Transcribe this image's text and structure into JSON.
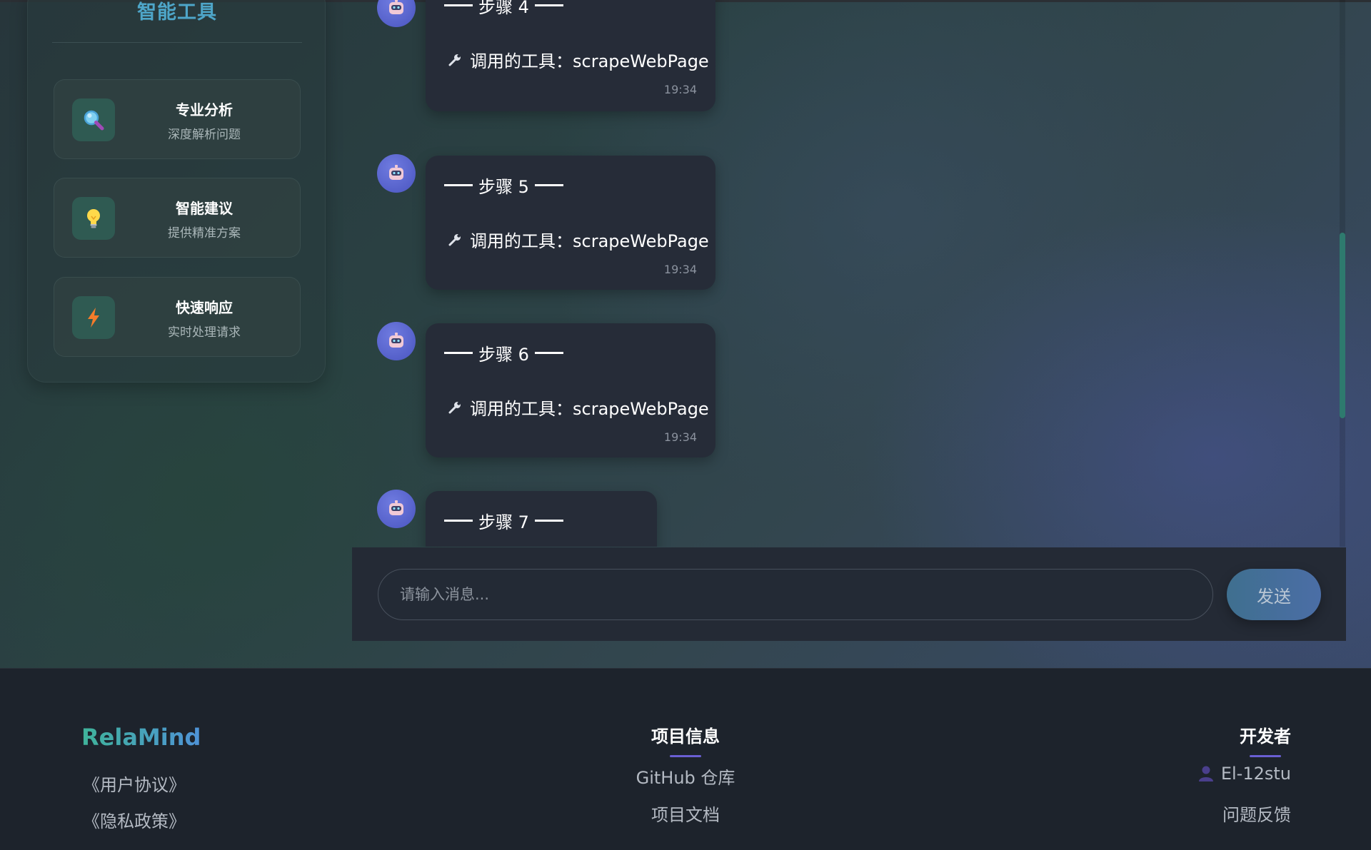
{
  "tools": {
    "title": "智能工具",
    "items": [
      {
        "name": "专业分析",
        "desc": "深度解析问题",
        "icon": "magnifier-icon"
      },
      {
        "name": "智能建议",
        "desc": "提供精准方案",
        "icon": "lightbulb-icon"
      },
      {
        "name": "快速响应",
        "desc": "实时处理请求",
        "icon": "lightning-icon"
      }
    ]
  },
  "chat": {
    "messages": [
      {
        "step": "步骤 4",
        "tool_text": "调用的工具：scrapeWebPage",
        "time": "19:34"
      },
      {
        "step": "步骤 5",
        "tool_text": "调用的工具：scrapeWebPage",
        "time": "19:34"
      },
      {
        "step": "步骤 6",
        "tool_text": "调用的工具：scrapeWebPage",
        "time": "19:34"
      },
      {
        "step": "步骤 7"
      }
    ],
    "input_placeholder": "请输入消息...",
    "send_label": "发送"
  },
  "footer": {
    "brand": "RelaMind",
    "agreement": "《用户协议》",
    "privacy": "《隐私政策》",
    "project_title": "项目信息",
    "github": "GitHub 仓库",
    "docs": "项目文档",
    "dev_title": "开发者",
    "dev_name": "El-12stu",
    "feedback": "问题反馈"
  },
  "colors": {
    "accent_teal": "#4ea6c9",
    "bubble_bg": "#262c38",
    "avatar": "#5b66d4",
    "underline": "#6a5fd4",
    "scroll_thumb": "#2e7a6e"
  }
}
